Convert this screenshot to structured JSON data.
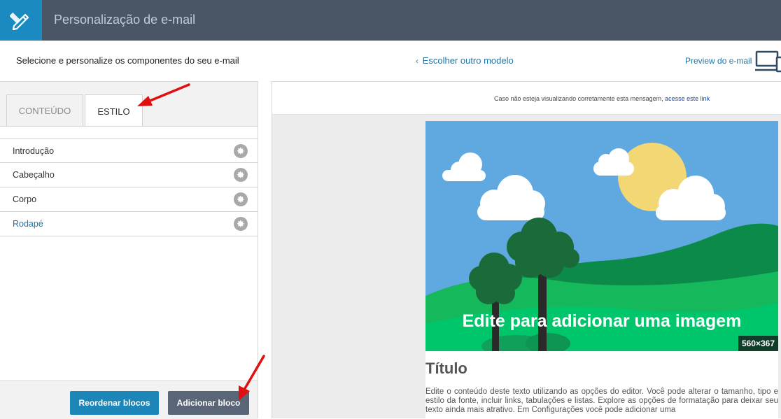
{
  "header": {
    "title": "Personalização de e-mail"
  },
  "subheader": {
    "instruction": "Selecione e personalize os componentes do seu e-mail",
    "back_link": "Escolher outro modelo",
    "preview_link": "Preview do e-mail"
  },
  "tabs": [
    {
      "label": "CONTEÚDO",
      "active": false
    },
    {
      "label": "ESTILO",
      "active": true
    }
  ],
  "style_items": [
    {
      "label": "Introdução"
    },
    {
      "label": "Cabeçalho"
    },
    {
      "label": "Corpo"
    },
    {
      "label": "Rodapé",
      "active": true
    }
  ],
  "buttons": {
    "reorder": "Reordenar blocos",
    "add": "Adicionar bloco"
  },
  "preview": {
    "notice_text": "Caso não esteja visualizando corretamente esta mensagem,",
    "notice_link": "acesse este link",
    "image_caption": "Edite para adicionar uma imagem",
    "image_dims": "560×367",
    "title": "Título",
    "body": "Edite o conteúdo deste texto utilizando as opções do editor. Você pode alterar o tamanho, tipo e estilo da fonte, incluir links, tabulações e listas. Explore as opções de formatação para deixar seu texto ainda mais atrativo. Em Configurações você pode adicionar uma"
  },
  "colors": {
    "header_bg": "#4a5565",
    "logo_bg": "#1a8ac0",
    "link": "#2373a4",
    "primary_button": "#1c86b9",
    "secondary_button": "#5a6677",
    "annotation_arrow": "#e01010"
  },
  "icons": {
    "logo": "pencil-ruler-icon",
    "devices": "devices-icon",
    "gear": "gear-icon",
    "back": "chevron-left-icon"
  }
}
